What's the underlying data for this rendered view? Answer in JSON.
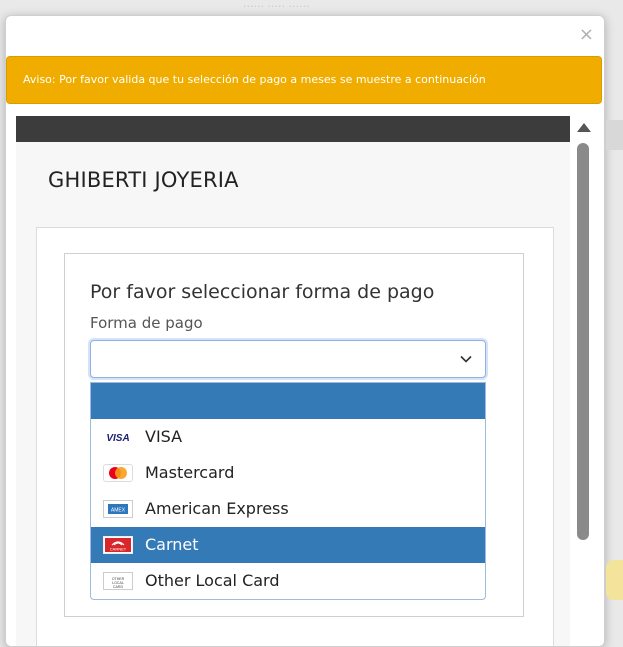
{
  "background": {
    "hint_text": "······ ····· ······"
  },
  "modal": {
    "close_label": "×",
    "warning_text": "Aviso: Por favor valida que tu selección de pago a meses se muestre a continuación",
    "merchant_name": "GHIBERTI JOYERIA",
    "form": {
      "title": "Por favor seleccionar forma de pago",
      "field_label": "Forma de pago",
      "selected_value": "",
      "options": [
        {
          "label": "",
          "icon": "blank",
          "state": "highlighted"
        },
        {
          "label": "VISA",
          "icon": "visa-logo-icon",
          "state": "normal"
        },
        {
          "label": "Mastercard",
          "icon": "mastercard-logo-icon",
          "state": "normal"
        },
        {
          "label": "American Express",
          "icon": "amex-logo-icon",
          "state": "normal"
        },
        {
          "label": "Carnet",
          "icon": "carnet-logo-icon",
          "state": "selected"
        },
        {
          "label": "Other Local Card",
          "icon": "other-local-card-icon",
          "state": "normal"
        }
      ],
      "logo_text": {
        "visa": "VISA",
        "amex": "AMEX",
        "carnet": "CARNET",
        "other": "OTHER LOCAL CARD"
      }
    }
  },
  "colors": {
    "warning": "#f0ad00",
    "highlight": "#337ab7",
    "frame_bar": "#3c3c3c"
  }
}
